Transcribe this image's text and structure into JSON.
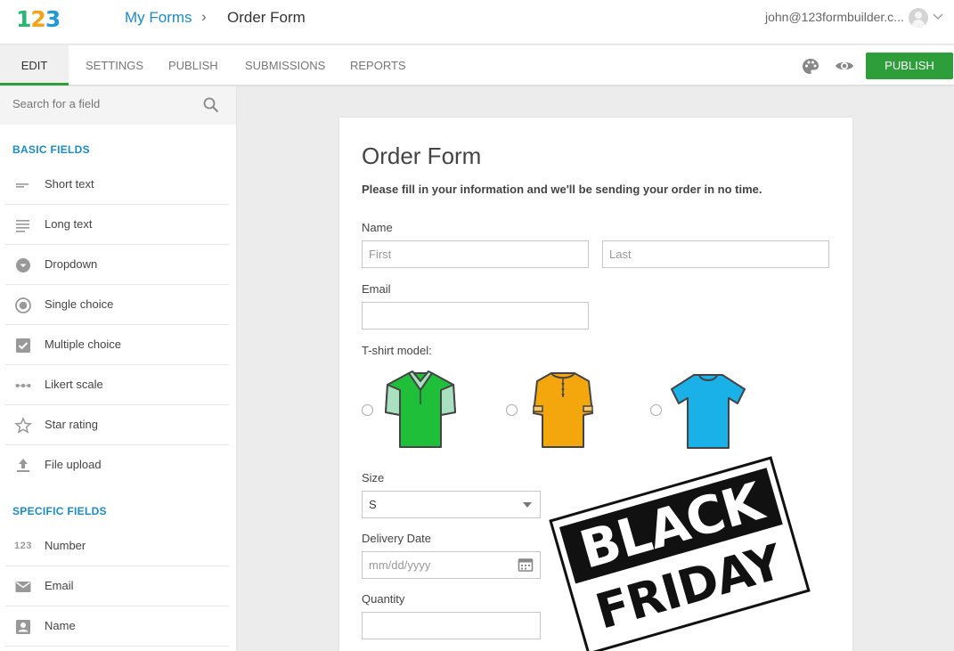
{
  "header": {
    "logo": [
      "1",
      "2",
      "3"
    ],
    "breadcrumb_link": "My Forms",
    "breadcrumb_sep": "›",
    "breadcrumb_current": "Order Form",
    "user_email": "john@123formbuilder.c..."
  },
  "tabs": [
    {
      "label": "EDIT",
      "active": true
    },
    {
      "label": "SETTINGS",
      "active": false
    },
    {
      "label": "PUBLISH",
      "active": false
    },
    {
      "label": "SUBMISSIONS",
      "active": false
    },
    {
      "label": "REPORTS",
      "active": false
    }
  ],
  "toolbar": {
    "publish_label": "PUBLISH",
    "publish_color": "#2e9e3a",
    "icons": [
      "palette-icon",
      "eye-icon"
    ]
  },
  "sidebar": {
    "search_placeholder": "Search for a field",
    "basic_title": "BASIC FIELDS",
    "basic_items": [
      {
        "label": "Short text",
        "icon": "short-text-icon"
      },
      {
        "label": "Long text",
        "icon": "long-text-icon"
      },
      {
        "label": "Dropdown",
        "icon": "dropdown-icon"
      },
      {
        "label": "Single choice",
        "icon": "single-choice-icon"
      },
      {
        "label": "Multiple choice",
        "icon": "multiple-choice-icon"
      },
      {
        "label": "Likert scale",
        "icon": "likert-scale-icon"
      },
      {
        "label": "Star rating",
        "icon": "star-icon"
      },
      {
        "label": "File upload",
        "icon": "upload-icon"
      }
    ],
    "specific_title": "SPECIFIC FIELDS",
    "specific_items": [
      {
        "label": "Number",
        "icon": "number-icon",
        "glyph": "123"
      },
      {
        "label": "Email",
        "icon": "envelope-icon"
      },
      {
        "label": "Name",
        "icon": "contact-card-icon"
      }
    ]
  },
  "form": {
    "title": "Order Form",
    "description": "Please fill in your information and we'll be sending your order in no time.",
    "name_label": "Name",
    "first_placeholder": "First",
    "last_placeholder": "Last",
    "email_label": "Email",
    "email_value": "",
    "tshirt_label": "T-shirt model:",
    "tshirts": [
      {
        "name": "green-polo",
        "color": "#1fbf3a",
        "accent": "#a8e0c0"
      },
      {
        "name": "orange-henley",
        "color": "#f4a60d"
      },
      {
        "name": "blue-tee",
        "color": "#1ab0e8"
      }
    ],
    "size_label": "Size",
    "size_value": "S",
    "date_label": "Delivery Date",
    "date_placeholder": "mm/dd/yyyy",
    "quantity_label": "Quantity",
    "quantity_value": ""
  },
  "promo": {
    "line1": "BLACK",
    "line2": "FRIDAY"
  }
}
